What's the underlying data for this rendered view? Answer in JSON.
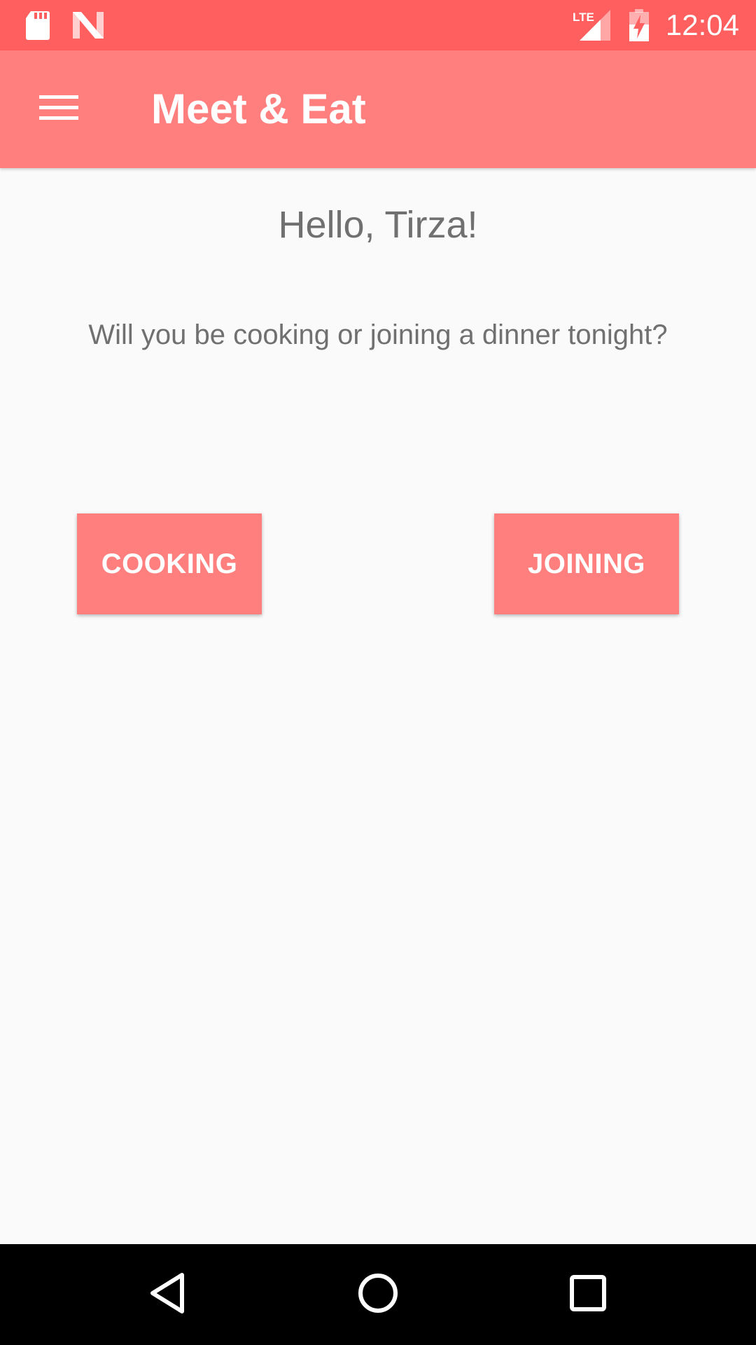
{
  "status_bar": {
    "time": "12:04",
    "icons": [
      "sd-card-icon",
      "n-logo-icon",
      "lte-signal-icon",
      "battery-charging-icon"
    ],
    "lte_label": "LTE",
    "background_color": "#ff5f5f"
  },
  "app_bar": {
    "title": "Meet & Eat",
    "menu_icon": "hamburger-menu-icon",
    "background_color": "#ff7f7f"
  },
  "main": {
    "greeting": "Hello, Tirza!",
    "question": "Will you be cooking or joining a dinner tonight?",
    "buttons": {
      "cooking_label": "COOKING",
      "joining_label": "JOINING"
    },
    "button_color": "#ff7f7f",
    "text_color": "#707070"
  },
  "nav_bar": {
    "icons": [
      "back-icon",
      "home-icon",
      "recents-icon"
    ]
  }
}
